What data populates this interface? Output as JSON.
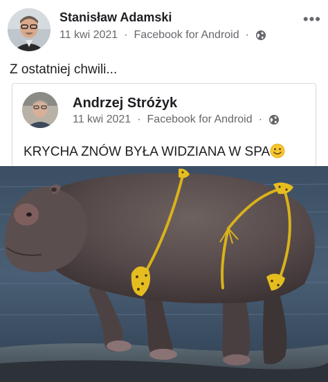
{
  "post": {
    "author": "Stanisław Adamski",
    "date": "11 kwi 2021",
    "separator": "·",
    "source": "Facebook for Android",
    "text": "Z ostatniej chwili...",
    "more_label": "•••"
  },
  "shared_post": {
    "author": "Andrzej Stróżyk",
    "date": "11 kwi 2021",
    "separator": "·",
    "source": "Facebook for Android",
    "text": "KRYCHA ZNÓW BYŁA WIDZIANA W SPA"
  },
  "icons": {
    "privacy": "globe-icon",
    "options": "more-options-icon",
    "emoji": "smiling-face-icon"
  },
  "colors": {
    "text": "#1c1e21",
    "secondary": "#65676b",
    "border": "#d5d8dc"
  }
}
